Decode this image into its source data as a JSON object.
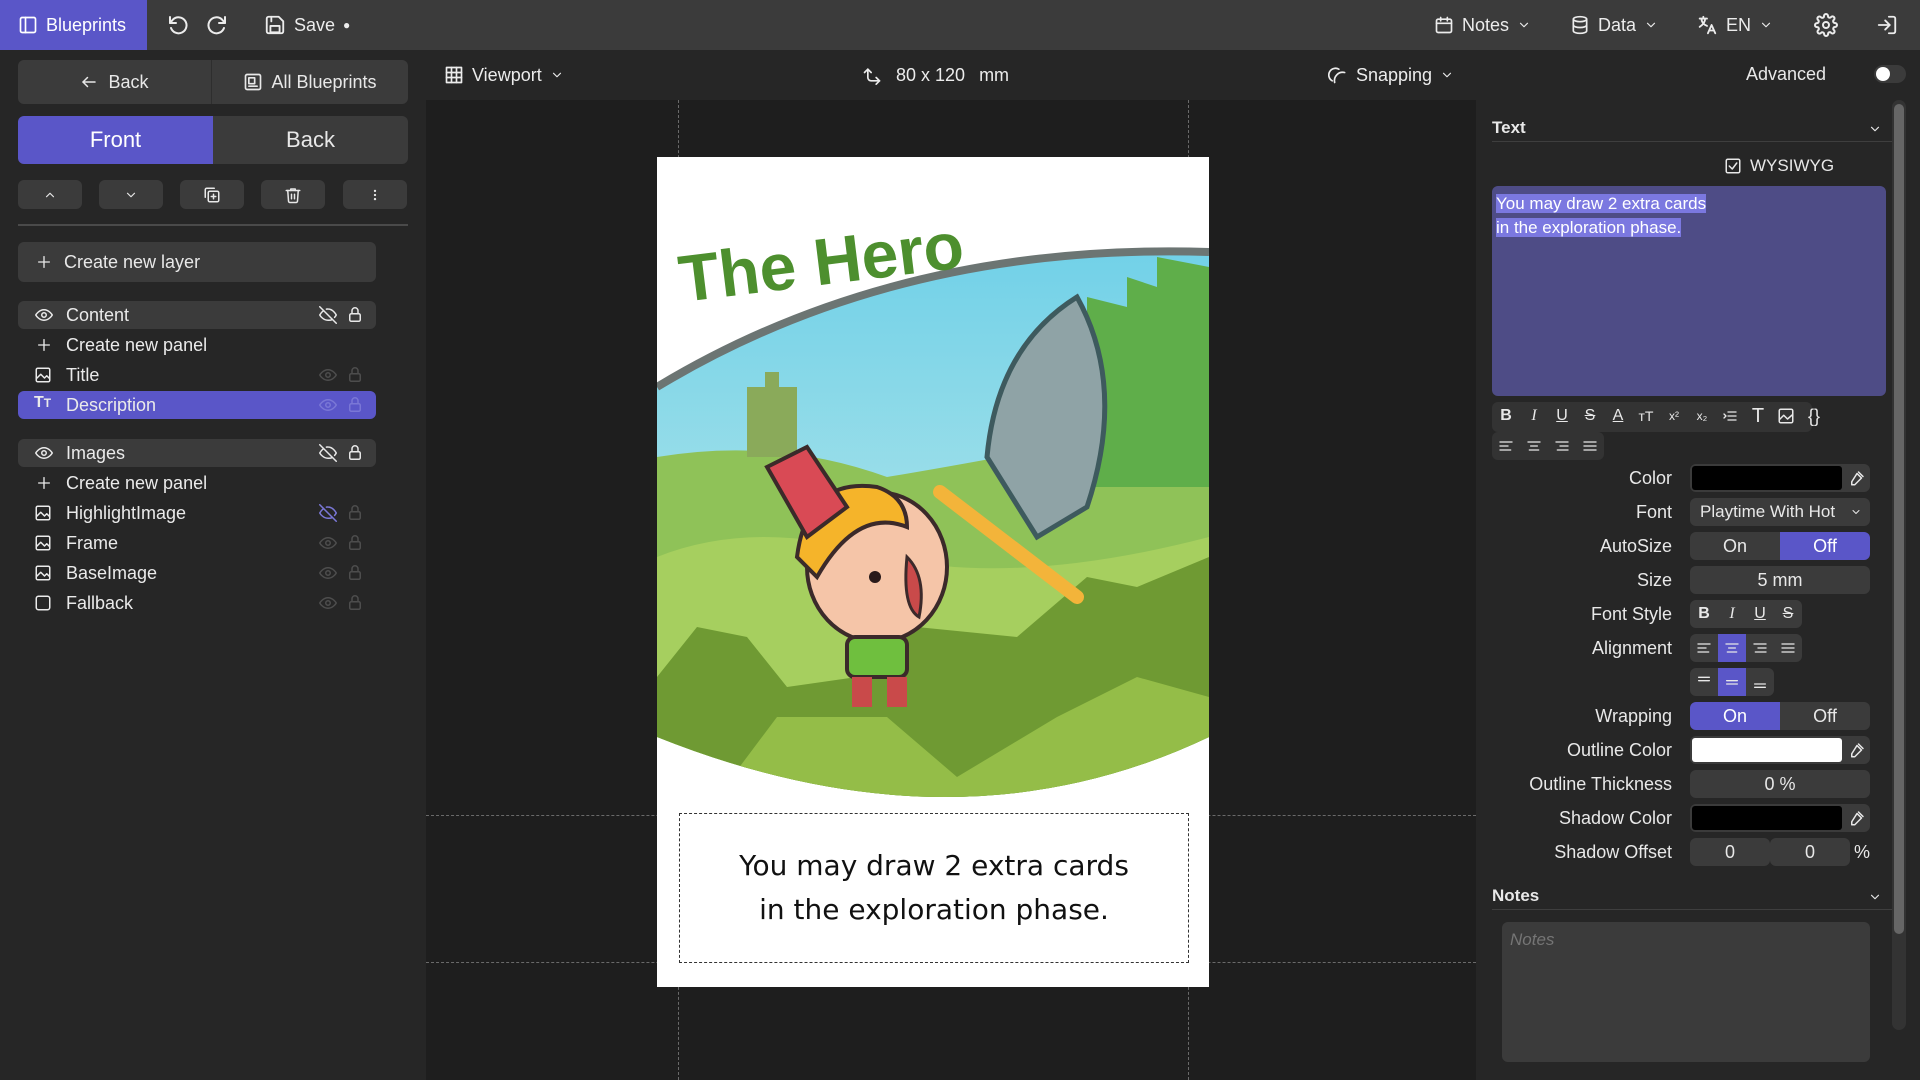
{
  "topbar": {
    "brand": "Blueprints",
    "save": "Save",
    "save_dot": "●",
    "notes": "Notes",
    "data": "Data",
    "lang": "EN"
  },
  "left": {
    "back": "Back",
    "all_blueprints": "All Blueprints",
    "tab_front": "Front",
    "tab_back": "Back",
    "create_layer": "Create new layer",
    "groups": [
      {
        "name": "Content",
        "create_panel": "Create new panel",
        "items": [
          {
            "label": "Title",
            "icon": "image-icon"
          },
          {
            "label": "Description",
            "icon": "text-icon"
          }
        ]
      },
      {
        "name": "Images",
        "create_panel": "Create new panel",
        "items": [
          {
            "label": "HighlightImage",
            "icon": "image-icon"
          },
          {
            "label": "Frame",
            "icon": "image-icon"
          },
          {
            "label": "BaseImage",
            "icon": "image-icon"
          },
          {
            "label": "Fallback",
            "icon": "square-icon"
          }
        ]
      }
    ]
  },
  "canvas": {
    "viewport": "Viewport",
    "size": "80 x 120",
    "unit": "mm",
    "snapping": "Snapping",
    "card_title": "The Hero",
    "card_text_1": "You may draw 2 extra cards",
    "card_text_2": "in the exploration phase."
  },
  "right": {
    "advanced": "Advanced",
    "section_text": "Text",
    "wysiwyg": "WYSIWYG",
    "editor_line_1": "You may draw 2 extra cards",
    "editor_line_2": "in the exploration phase.",
    "labels": {
      "color": "Color",
      "font": "Font",
      "autosize": "AutoSize",
      "size": "Size",
      "font_style": "Font Style",
      "alignment": "Alignment",
      "wrapping": "Wrapping",
      "outline_color": "Outline Color",
      "outline_thickness": "Outline Thickness",
      "shadow_color": "Shadow Color",
      "shadow_offset": "Shadow Offset"
    },
    "font_value": "Playtime With Hot",
    "on": "On",
    "off": "Off",
    "size_value": "5 mm",
    "outline_thickness_value": "0 %",
    "shadow_x": "0",
    "shadow_y": "0",
    "percent": "%",
    "section_notes": "Notes",
    "notes_placeholder": "Notes",
    "colors": {
      "text_color": "#000000",
      "outline_color": "#ffffff",
      "shadow_color": "#000000",
      "accent": "#5a56c8"
    }
  }
}
